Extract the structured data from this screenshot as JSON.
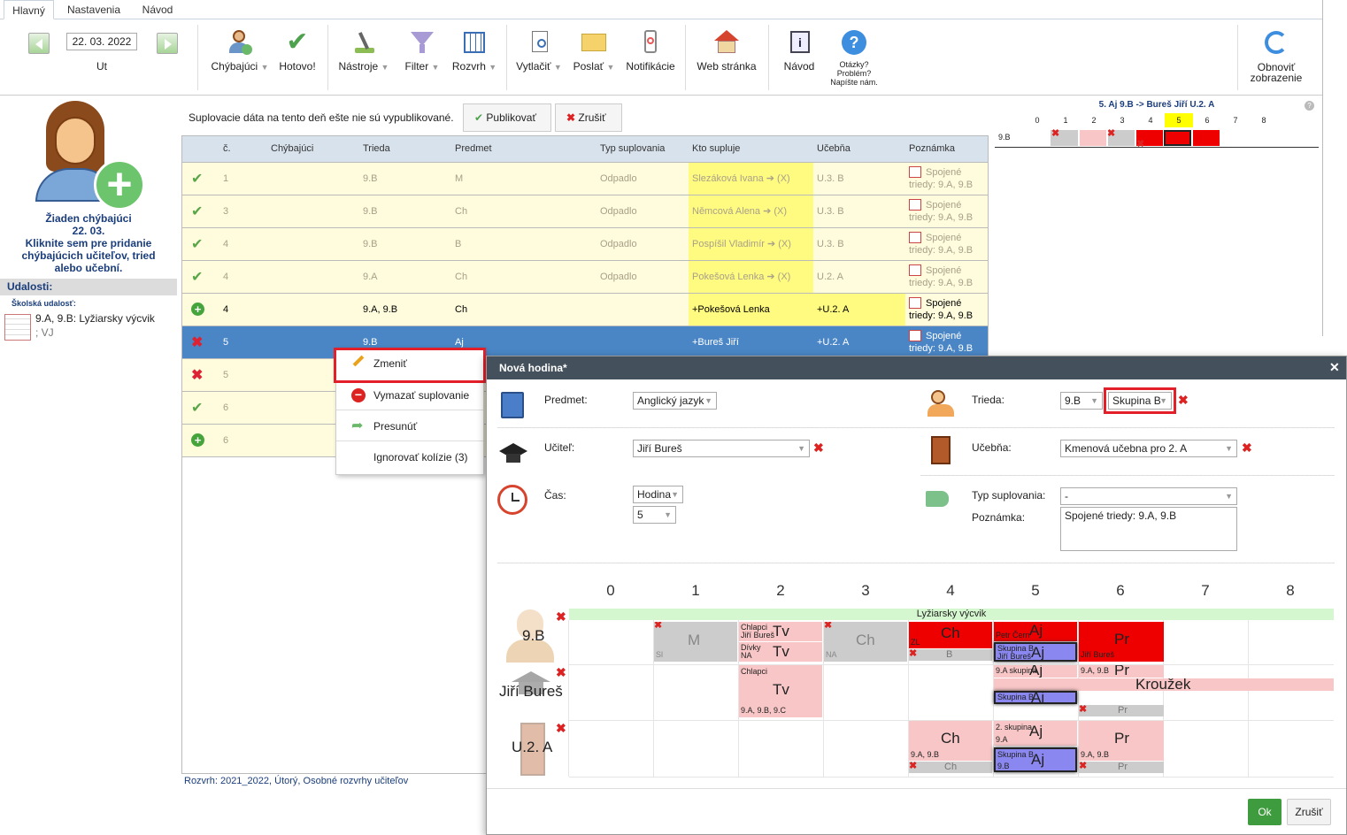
{
  "tabs": [
    "Hlavný",
    "Nastavenia",
    "Návod"
  ],
  "toolbar": {
    "date": "22. 03. 2022",
    "day": "Ut",
    "buttons": {
      "chybajuci": "Chýbajúci",
      "hotovo": "Hotovo!",
      "nastroje": "Nástroje",
      "filter": "Filter",
      "rozvrh": "Rozvrh",
      "vytlacit": "Vytlačiť",
      "poslat": "Poslať",
      "notifikacie": "Notifikácie",
      "web": "Web stránka",
      "navod": "Návod",
      "otazky1": "Otázky?",
      "otazky2": "Problém?",
      "otazky3": "Napíšte nám.",
      "obnovit1": "Obnoviť",
      "obnovit2": "zobrazenie"
    }
  },
  "left": {
    "line1": "Žiaden chýbajúci",
    "line2": "22. 03.",
    "line3": "Kliknite sem pre pridanie",
    "line4": "chýbajúcich učiteľov, tried",
    "line5": "alebo učební.",
    "events_title": "Udalosti:",
    "event_type": "Školská udalosť:",
    "event_text1": "9.A, 9.B: Lyžiarsky výcvik",
    "event_text2": "; VJ"
  },
  "notice": {
    "text": "Suplovacie dáta na tento deň ešte nie sú vypublikované.",
    "publish": "Publikovať",
    "cancel": "Zrušiť"
  },
  "table": {
    "headers": [
      "č.",
      "Chýbajúci",
      "Trieda",
      "Predmet",
      "Typ suplovania",
      "Kto supluje",
      "Učebňa",
      "Poznámka"
    ],
    "rows": [
      {
        "status": "check",
        "no": "1",
        "missing": "",
        "cls": "9.B",
        "subj": "M",
        "type": "Odpadlo",
        "who": "Slezáková Ivana ➔ (X)",
        "room": "U.3. B",
        "note1": "Spojené",
        "note2": "triedy: 9.A, 9.B"
      },
      {
        "status": "check",
        "no": "3",
        "missing": "",
        "cls": "9.B",
        "subj": "Ch",
        "type": "Odpadlo",
        "who": "Němcová Alena ➔ (X)",
        "room": "U.3. B",
        "note1": "Spojené",
        "note2": "triedy: 9.A, 9.B"
      },
      {
        "status": "check",
        "no": "4",
        "missing": "",
        "cls": "9.B",
        "subj": "B",
        "type": "Odpadlo",
        "who": "Pospíšil Vladimír ➔ (X)",
        "room": "U.3. B",
        "note1": "Spojené",
        "note2": "triedy: 9.A, 9.B"
      },
      {
        "status": "check",
        "no": "4",
        "missing": "",
        "cls": "9.A",
        "subj": "Ch",
        "type": "Odpadlo",
        "who": "Pokešová Lenka ➔ (X)",
        "room": "U.2. A",
        "note1": "Spojené",
        "note2": "triedy: 9.A, 9.B"
      },
      {
        "status": "plus",
        "no": "4",
        "missing": "",
        "cls": "9.A, 9.B",
        "subj": "Ch",
        "type": "",
        "who": "+Pokešová Lenka",
        "room": "+U.2. A",
        "note1": "Spojené",
        "note2": "triedy: 9.A, 9.B"
      },
      {
        "status": "x",
        "no": "5",
        "missing": "",
        "cls": "9.B",
        "subj": "Aj",
        "type": "",
        "who": "+Bureš Jiří",
        "room": "+U.2. A",
        "note1": "Spojené",
        "note2": "triedy: 9.A, 9.B"
      },
      {
        "status": "x",
        "no": "5",
        "missing": "",
        "cls": "",
        "subj": "",
        "type": "",
        "who": "",
        "room": "",
        "note1": "",
        "note2": ""
      },
      {
        "status": "check",
        "no": "6",
        "missing": "",
        "cls": "",
        "subj": "",
        "type": "",
        "who": "",
        "room": "",
        "note1": "",
        "note2": ""
      },
      {
        "status": "plus",
        "no": "6",
        "missing": "",
        "cls": "",
        "subj": "",
        "type": "",
        "who": "",
        "room": "",
        "note1": "",
        "note2": ""
      }
    ],
    "footer": "Rozvrh: 2021_2022, Útorý, Osobné rozvrhy učiteľov"
  },
  "context_menu": [
    "Zmeniť",
    "Vymazať suplovanie",
    "Presunúť",
    "Ignorovať kolízie (3)"
  ],
  "mini": {
    "title": "5. Aj 9.B -> Bureš Jiří U.2. A",
    "cols": [
      "0",
      "1",
      "2",
      "3",
      "4",
      "5",
      "6",
      "7",
      "8"
    ],
    "row": "9.B"
  },
  "dialog": {
    "title": "Nová hodina*",
    "predmet_label": "Predmet:",
    "predmet_value": "Anglický jazyk",
    "ucitel_label": "Učiteľ:",
    "ucitel_value": "Jiří Bureš",
    "cas_label": "Čas:",
    "cas_value": "Hodina",
    "hodina_value": "5",
    "trieda_label": "Trieda:",
    "trieda_value": "9.B",
    "skupina_value": "Skupina B",
    "ucebna_label": "Učebňa:",
    "ucebna_value": "Kmenová učebna pro 2. A",
    "typ_label": "Typ suplovania:",
    "typ_value": "-",
    "poznamka_label": "Poznámka:",
    "poznamka_value": "Spojené triedy: 9.A, 9.B",
    "ok": "Ok",
    "cancel": "Zrušiť",
    "grid_cols": [
      "0",
      "1",
      "2",
      "3",
      "4",
      "5",
      "6",
      "7",
      "8"
    ],
    "row_labels": [
      "9.B",
      "Jiří Bureš",
      "U.2. A"
    ],
    "banner": "Lyžiarsky výcvik",
    "cells": {
      "r1_m": "M",
      "r1_m_sub": "Sl",
      "r1_tv1_a": "Chlapci",
      "r1_tv1_b": "Jiří Bureš",
      "r1_tv1": "Tv",
      "r1_tv2_a": "Dívky",
      "r1_tv2_b": "NA",
      "r1_tv2": "Tv",
      "r1_ch": "Ch",
      "r1_ch_sub": "NA",
      "r1_ch4": "Ch",
      "r1_ch4_sub": "ZL",
      "r1_b": "B",
      "r1_aj_a": "Petr Čern",
      "r1_aj": "Aj",
      "r1_aj2_a": "Skupina B",
      "r1_aj2_b": "Jiří Bureš",
      "r1_aj2": "Aj",
      "r1_pr": "Pr",
      "r1_pr_sub": "Jiří Bureš",
      "r2_tv_a": "Chlapci",
      "r2_tv": "Tv",
      "r2_tv_b": "9.A, 9.B, 9.C",
      "r2_aj_a": "9.A skupina",
      "r2_aj": "Aj",
      "r2_pr_a": "9.A, 9.B",
      "r2_pr": "Pr",
      "r2_krouzek": "Kroužek",
      "r2_aj2_a": "Skupina B",
      "r2_aj2": "Aj",
      "r2_pr2": "Pr",
      "r3_ch": "Ch",
      "r3_ch_a": "9.A, 9.B",
      "r3_ch_sub": "Ch",
      "r3_aj_a": "2. skupina",
      "r3_aj_b": "9.A",
      "r3_aj": "Aj",
      "r3_aj2_a": "Skupina B",
      "r3_aj2_b": "9.B",
      "r3_aj2": "Aj",
      "r3_pr": "Pr",
      "r3_pr_a": "9.A, 9.B",
      "r3_pr_sub": "Pr"
    }
  },
  "colors": {
    "accent": "#4a86c5",
    "red_highlight": "#e3202a",
    "ok_green": "#3e9c3e"
  }
}
